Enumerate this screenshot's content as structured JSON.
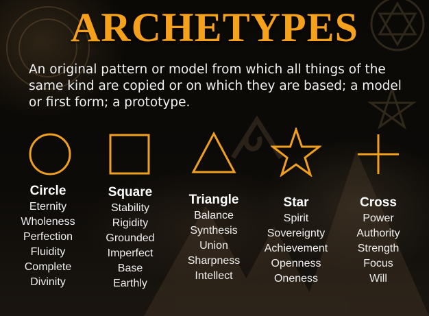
{
  "title": "ARCHETYPES",
  "definition": "An original pattern or model from which all things of the same kind are copied or on which they are based; a model or first form; a prototype.",
  "colors": {
    "title": "#f5a11c",
    "symbol": "#f0a020",
    "text": "#f2f2f2"
  },
  "archetypes": [
    {
      "icon": "circle-icon",
      "name": "Circle",
      "traits": [
        "Eternity",
        "Wholeness",
        "Perfection",
        "Fluidity",
        "Complete",
        "Divinity"
      ]
    },
    {
      "icon": "square-icon",
      "name": "Square",
      "traits": [
        "Stability",
        "Rigidity",
        "Grounded",
        "Imperfect",
        "Base",
        "Earthly"
      ]
    },
    {
      "icon": "triangle-icon",
      "name": "Triangle",
      "traits": [
        "Balance",
        "Synthesis",
        "Union",
        "Sharpness",
        "Intellect"
      ]
    },
    {
      "icon": "star-icon",
      "name": "Star",
      "traits": [
        "Spirit",
        "Sovereignty",
        "Achievement",
        "Openness",
        "Oneness"
      ]
    },
    {
      "icon": "cross-icon",
      "name": "Cross",
      "traits": [
        "Power",
        "Authority",
        "Strength",
        "Focus",
        "Will"
      ]
    }
  ]
}
